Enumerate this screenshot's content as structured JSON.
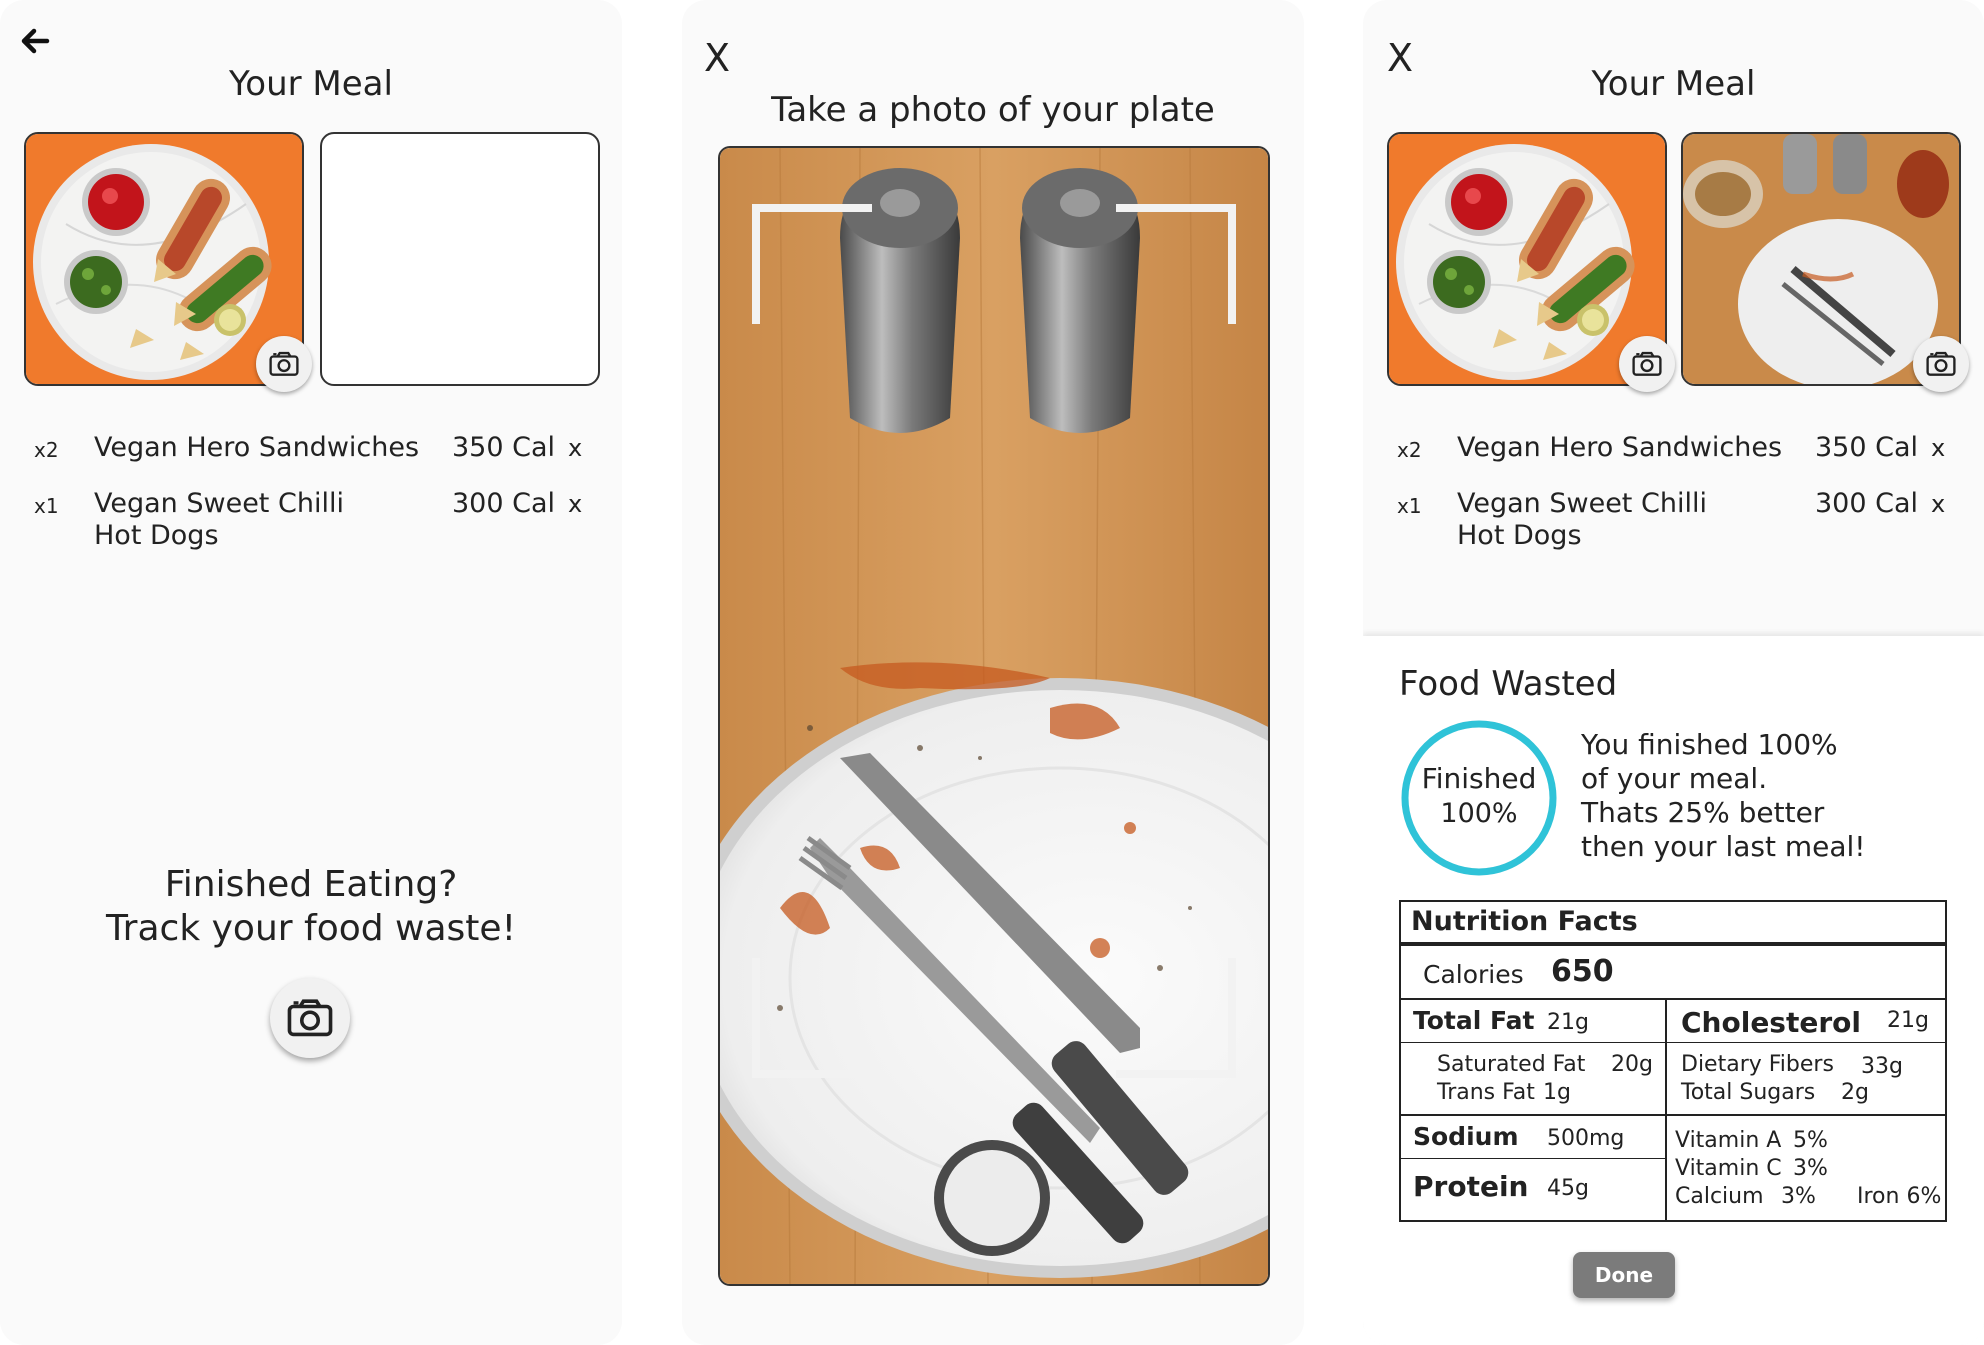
{
  "screen1": {
    "title": "Your Meal",
    "items": [
      {
        "qty": "x2",
        "name": "Vegan Hero Sandwiches",
        "cal": "350 Cal",
        "remove": "x"
      },
      {
        "qty": "x1",
        "name_line1": "Vegan Sweet Chilli",
        "name_line2": "Hot Dogs",
        "cal": "300 Cal",
        "remove": "x"
      }
    ],
    "prompt_line1": "Finished Eating?",
    "prompt_line2": "Track your food waste!"
  },
  "screen2": {
    "close": "X",
    "title": "Take a photo of your plate"
  },
  "screen3": {
    "close": "X",
    "title": "Your Meal",
    "items": [
      {
        "qty": "x2",
        "name": "Vegan Hero Sandwiches",
        "cal": "350 Cal",
        "remove": "x"
      },
      {
        "qty": "x1",
        "name_line1": "Vegan Sweet Chilli",
        "name_line2": "Hot Dogs",
        "cal": "300 Cal",
        "remove": "x"
      }
    ],
    "waste_heading": "Food Wasted",
    "ring_label": "Finished",
    "ring_value": "100%",
    "ring_fraction": 1.0,
    "message": [
      "You finished 100%",
      "of your meal.",
      "Thats 25% better",
      "then your last meal!"
    ],
    "nutrition": {
      "heading": "Nutrition Facts",
      "calories_label": "Calories",
      "calories_value": "650",
      "total_fat_label": "Total Fat",
      "total_fat_value": "21g",
      "cholesterol_label": "Cholesterol",
      "cholesterol_value": "21g",
      "sat_fat_label": "Saturated Fat",
      "sat_fat_value": "20g",
      "trans_fat_label": "Trans Fat",
      "trans_fat_value": "1g",
      "fibers_label": "Dietary Fibers",
      "fibers_value": "33g",
      "sugars_label": "Total Sugars",
      "sugars_value": "2g",
      "sodium_label": "Sodium",
      "sodium_value": "500mg",
      "protein_label": "Protein",
      "protein_value": "45g",
      "vita_label": "Vitamin A",
      "vita_value": "5%",
      "vitc_label": "Vitamin C",
      "vitc_value": "3%",
      "calcium_label": "Calcium",
      "calcium_value": "3%",
      "iron": "Iron 6%"
    },
    "done_label": "Done"
  },
  "colors": {
    "accent_ring": "#2fc3d8",
    "done_button": "#7b7b7b",
    "orange_bg": "#f07a2c"
  }
}
